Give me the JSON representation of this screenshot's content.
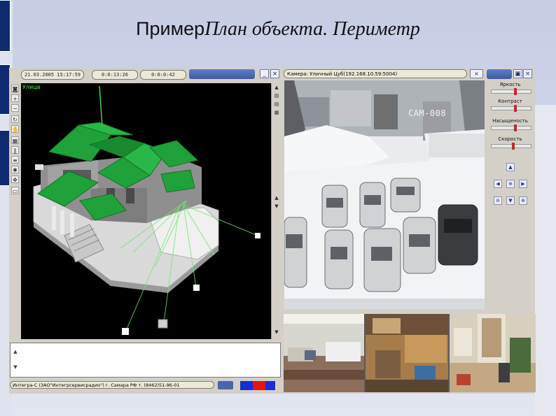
{
  "slide": {
    "title_prefix": "Пример",
    "title_main": "План объекта. Периметр"
  },
  "plan_window": {
    "date_field": "21.03.2005 15:17:59",
    "time_field_1": "0:6:13:26",
    "time_field_2": "0:0:0:42",
    "minimize_label": "_",
    "close_label": "×",
    "view_label": "Улица",
    "toolbar_icons": [
      "camera-icon",
      "zoom-in-icon",
      "zoom-out-icon",
      "rotate-icon",
      "hand-icon",
      "grid-icon",
      "pause-icon",
      "list-icon",
      "settings-icon",
      "move-icon",
      "select-icon"
    ],
    "scroll_up": "▲",
    "scroll_down": "▼"
  },
  "status": {
    "text": "Интегра-С (ЗАО\"Интегрсервисрадио\") г. Самара РФ т. (8462)51-96-01"
  },
  "camera": {
    "title": "Камера: Уличный Цуб(192.168.10.59:5004)",
    "close_label": "×",
    "overlay_label": "CAM-008"
  },
  "controls": {
    "brightness_label": "Яркость",
    "contrast_label": "Контраст",
    "saturation_label": "Насыщеность",
    "speed_label": "Скорость",
    "brightness_value": 0.6,
    "contrast_value": 0.6,
    "saturation_value": 0.6,
    "speed_value": 0.55,
    "btn_up": "▲",
    "btn_left": "◀",
    "btn_center": "⊕",
    "btn_right": "▶",
    "btn_zoom_out": "⊖",
    "btn_down": "▼",
    "btn_zoom_in": "⊕"
  },
  "colors": {
    "title_bar": "#3b5aa4",
    "roof_green": "#1fa23a",
    "sensor_line": "#6ee86e",
    "swatch_blue": "#1b2bd6",
    "swatch_red": "#e01515"
  }
}
